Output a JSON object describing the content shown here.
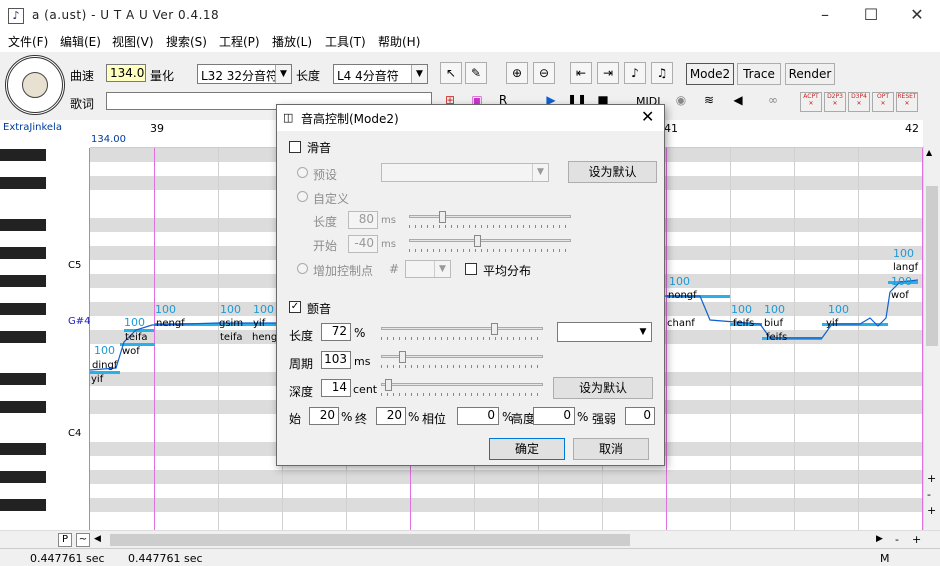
{
  "window": {
    "title": "a (a.ust) - U T A U Ver 0.4.18",
    "icon": "music-note-icon"
  },
  "menu": [
    "文件(F)",
    "编辑(E)",
    "视图(V)",
    "搜索(S)",
    "工程(P)",
    "播放(L)",
    "工具(T)",
    "帮助(H)"
  ],
  "toolbar": {
    "tempo_label": "曲速",
    "tempo_value": "134.0",
    "quantize_label": "量化",
    "quantize_value": "L32 32分音符",
    "length_label": "长度",
    "length_value": "L4 4分音符",
    "lyric_label": "歌词",
    "lyric_value": "",
    "mode2_label": "Mode2",
    "trace_label": "Trace",
    "render_label": "Render",
    "midi_label": "MIDI",
    "plugin_labels": [
      "ACPT",
      "D2P3",
      "D3P4",
      "OPT",
      "RESET"
    ]
  },
  "roll": {
    "voicebank": "ExtraJinkela",
    "tempo_marker": "134.00",
    "measures": [
      "39",
      "41",
      "42"
    ],
    "key_labels": [
      "C5",
      "G#4",
      "C4"
    ],
    "pitch_values": [
      "100",
      "100",
      "100",
      "100",
      "100",
      "100",
      "100",
      "100",
      "100",
      "100",
      "100",
      "100",
      "100"
    ],
    "lyrics": [
      "nengf",
      "gsim",
      "yif",
      "teifa",
      "heng",
      "teifa",
      "wof",
      "dingf",
      "yif",
      "nongf",
      "chanf",
      "feifs",
      "biuf",
      "feifs",
      "yif",
      "langf",
      "wof"
    ]
  },
  "dialog": {
    "title": "音高控制(Mode2)",
    "portamento_label": "滑音",
    "preset_label": "预设",
    "set_default_label": "设为默认",
    "custom_label": "自定义",
    "length_label": "长度",
    "length_value": "80",
    "length_unit": "ms",
    "start_label": "开始",
    "start_value": "-40",
    "start_unit": "ms",
    "add_point_label": "增加控制点",
    "hash_label": "#",
    "even_label": "平均分布",
    "vibrato_label": "颤音",
    "vib_length_label": "长度",
    "vib_length_value": "72",
    "vib_length_unit": "%",
    "vib_period_label": "周期",
    "vib_period_value": "103",
    "vib_period_unit": "ms",
    "vib_depth_label": "深度",
    "vib_depth_value": "14",
    "vib_depth_unit": "cent",
    "vib_set_default_label": "设为默认",
    "in_label": "始",
    "in_value": "20",
    "in_unit": "%",
    "out_label": "终",
    "out_value": "20",
    "out_unit": "%",
    "phase_label": "相位",
    "phase_value": "0",
    "phase_unit": "%",
    "height_label": "高度",
    "height_value": "0",
    "height_unit": "%",
    "strength_label": "强弱",
    "strength_value": "0",
    "ok_label": "确定",
    "cancel_label": "取消"
  },
  "status": {
    "left_time": "0.447761 sec",
    "right_time": "0.447761 sec",
    "mode": "M"
  },
  "scroll": {
    "p_label": "P",
    "tilde_label": "~"
  }
}
